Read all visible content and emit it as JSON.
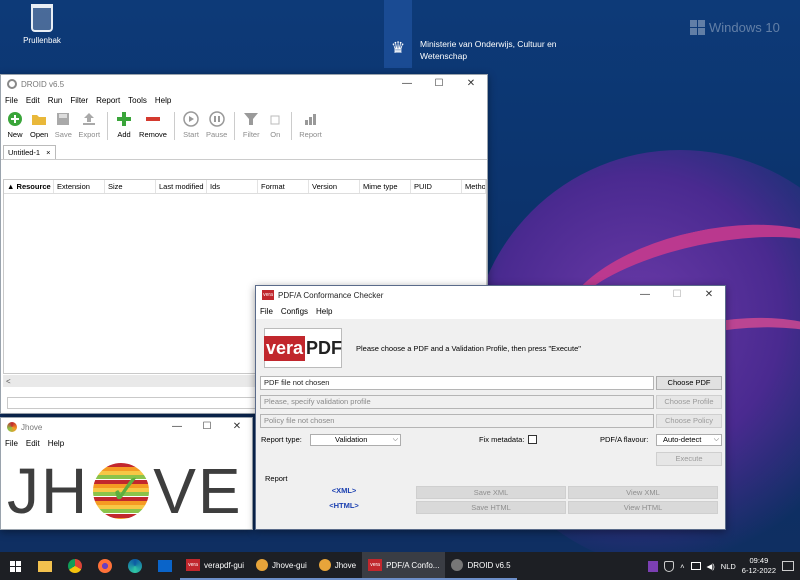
{
  "desktop": {
    "recycle_bin": "Prullenbak",
    "ministry_line1": "Ministerie van Onderwijs, Cultuur en",
    "ministry_line2": "Wetenschap",
    "windows_brand": "Windows 10"
  },
  "droid": {
    "title": "DROID v6.5",
    "menu": [
      "File",
      "Edit",
      "Run",
      "Filter",
      "Report",
      "Tools",
      "Help"
    ],
    "toolbar": [
      {
        "label": "New",
        "icon": "new-icon",
        "enabled": true
      },
      {
        "label": "Open",
        "icon": "open-folder-icon",
        "enabled": true
      },
      {
        "label": "Save",
        "icon": "save-icon",
        "enabled": false
      },
      {
        "label": "Export",
        "icon": "export-icon",
        "enabled": false
      },
      {
        "label": "Add",
        "icon": "add-icon",
        "enabled": true
      },
      {
        "label": "Remove",
        "icon": "remove-icon",
        "enabled": true
      },
      {
        "label": "Start",
        "icon": "play-icon",
        "enabled": false
      },
      {
        "label": "Pause",
        "icon": "pause-icon",
        "enabled": false
      },
      {
        "label": "Filter",
        "icon": "filter-icon",
        "enabled": false
      },
      {
        "label": "On",
        "icon": "checkbox-icon",
        "enabled": false
      },
      {
        "label": "Report",
        "icon": "report-icon",
        "enabled": false
      }
    ],
    "tab": "Untitled-1",
    "tab_close": "×",
    "columns": [
      "Resource",
      "Extension",
      "Size",
      "Last modified",
      "Ids",
      "Format",
      "Version",
      "Mime type",
      "PUID",
      "Method"
    ],
    "sort_indicator": "▲",
    "scroll_left": "<"
  },
  "jhove": {
    "title": "Jhove",
    "menu": [
      "File",
      "Edit",
      "Help"
    ],
    "logo_left": "JH",
    "logo_right": "VE"
  },
  "vera": {
    "title": "PDF/A Conformance Checker",
    "badge": "vera",
    "menu": [
      "File",
      "Configs",
      "Help"
    ],
    "logo_vera": "vera",
    "logo_pdf": "PDF",
    "instruction": "Please choose a PDF and a Validation Profile, then press \"Execute\"",
    "pdf_field": "PDF file not chosen",
    "choose_pdf": "Choose PDF",
    "profile_placeholder": "Please, specify validation profile",
    "choose_profile": "Choose Profile",
    "policy_field": "Policy file not chosen",
    "choose_policy": "Choose Policy",
    "report_type_label": "Report type:",
    "report_type_value": "Validation",
    "fix_metadata_label": "Fix metadata:",
    "fix_metadata_checked": false,
    "flavour_label": "PDF/A flavour:",
    "flavour_value": "Auto-detect",
    "execute": "Execute",
    "report_label": "Report",
    "xml_link": "<XML>",
    "html_link": "<HTML>",
    "save_xml": "Save XML",
    "view_xml": "View XML",
    "save_html": "Save HTML",
    "view_html": "View HTML"
  },
  "window_controls": {
    "minimize": "—",
    "maximize": "☐",
    "close": "✕"
  },
  "taskbar": {
    "tasks": [
      {
        "label": "verapdf-gui",
        "icon": "verapdf-icon",
        "active": false
      },
      {
        "label": "Jhove-gui",
        "icon": "jhove-icon",
        "active": false
      },
      {
        "label": "Jhove",
        "icon": "jhove-icon",
        "active": false
      },
      {
        "label": "PDF/A Confo...",
        "icon": "verapdf-icon",
        "active": true
      },
      {
        "label": "DROID v6.5",
        "icon": "droid-icon",
        "active": false
      }
    ],
    "language": "NLD",
    "time": "09:49",
    "date": "6-12-2022"
  }
}
